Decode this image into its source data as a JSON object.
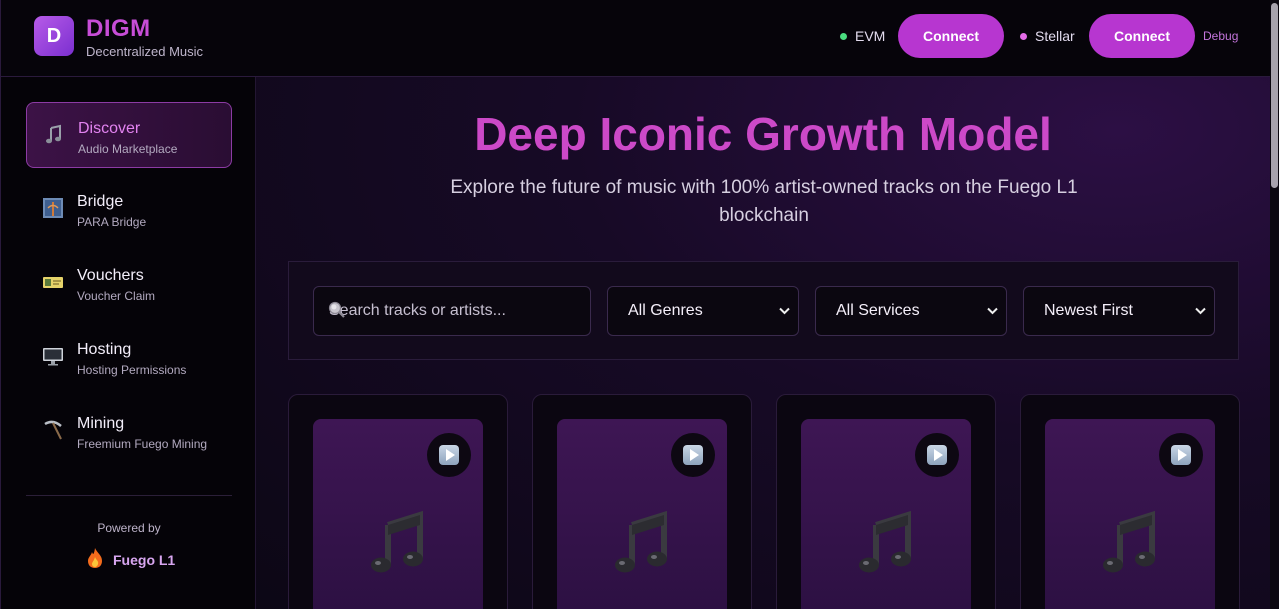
{
  "brand": {
    "logo_letter": "D",
    "title": "DIGM",
    "subtitle": "Decentralized Music"
  },
  "header": {
    "networks": [
      {
        "name": "EVM",
        "status_color": "#4ade80",
        "connect_label": "Connect"
      },
      {
        "name": "Stellar",
        "status_color": "#e46be8",
        "connect_label": "Connect"
      }
    ],
    "debug_label": "Debug"
  },
  "sidebar": {
    "items": [
      {
        "label": "Discover",
        "sub": "Audio Marketplace",
        "icon": "music-note-icon",
        "active": true
      },
      {
        "label": "Bridge",
        "sub": "PARA Bridge",
        "icon": "bridge-icon",
        "active": false
      },
      {
        "label": "Vouchers",
        "sub": "Voucher Claim",
        "icon": "ticket-icon",
        "active": false
      },
      {
        "label": "Hosting",
        "sub": "Hosting Permissions",
        "icon": "monitor-icon",
        "active": false
      },
      {
        "label": "Mining",
        "sub": "Freemium Fuego Mining",
        "icon": "pickaxe-icon",
        "active": false
      }
    ],
    "powered_by": "Powered by",
    "network_name": "Fuego L1"
  },
  "main": {
    "title": "Deep Iconic Growth Model",
    "subtitle": "Explore the future of music with 100% artist-owned tracks on the Fuego L1 blockchain",
    "search": {
      "placeholder": "Search tracks or artists...",
      "value": ""
    },
    "filters": {
      "genre": "All Genres",
      "service": "All Services",
      "sort": "Newest First"
    },
    "cards": [
      {
        "icon": "music-note-icon",
        "play_icon": "play-button-icon"
      },
      {
        "icon": "music-note-icon",
        "play_icon": "play-button-icon"
      },
      {
        "icon": "music-note-icon",
        "play_icon": "play-button-icon"
      },
      {
        "icon": "music-note-icon",
        "play_icon": "play-button-icon"
      }
    ]
  },
  "colors": {
    "accent": "#b736d0",
    "title_gradient_start": "#b93fd6",
    "title_gradient_end": "#de4f9c"
  }
}
